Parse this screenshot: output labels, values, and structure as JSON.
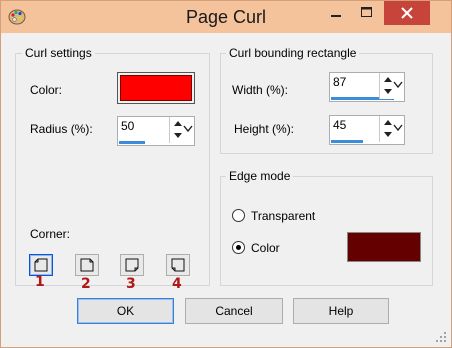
{
  "window": {
    "title": "Page Curl",
    "icons": [
      "palette-icon",
      "minimize-icon",
      "maximize-icon",
      "close-icon"
    ]
  },
  "curl_settings": {
    "legend": "Curl settings",
    "color_label": "Color:",
    "color_value": "#ff0000",
    "radius_label": "Radius (%):",
    "radius_value": "50",
    "radius_level": 0.5
  },
  "bounding": {
    "legend": "Curl bounding rectangle",
    "width_label": "Width (%):",
    "width_value": "87",
    "width_level": 0.87,
    "height_label": "Height (%):",
    "height_value": "45",
    "height_level": 0.45
  },
  "edge_mode": {
    "legend": "Edge mode",
    "transparent_label": "Transparent",
    "color_label": "Color",
    "selected": "Color",
    "color_value": "#640000"
  },
  "corner": {
    "label": "Corner:",
    "options": [
      "1",
      "2",
      "3",
      "4"
    ],
    "selected": "1",
    "number_color": "#b01818"
  },
  "buttons": {
    "ok": "OK",
    "cancel": "Cancel",
    "help": "Help"
  },
  "colors": {
    "title_bar": "#f4c29b",
    "close_button": "#c7443a",
    "focus_blue": "#3c8cdc"
  }
}
